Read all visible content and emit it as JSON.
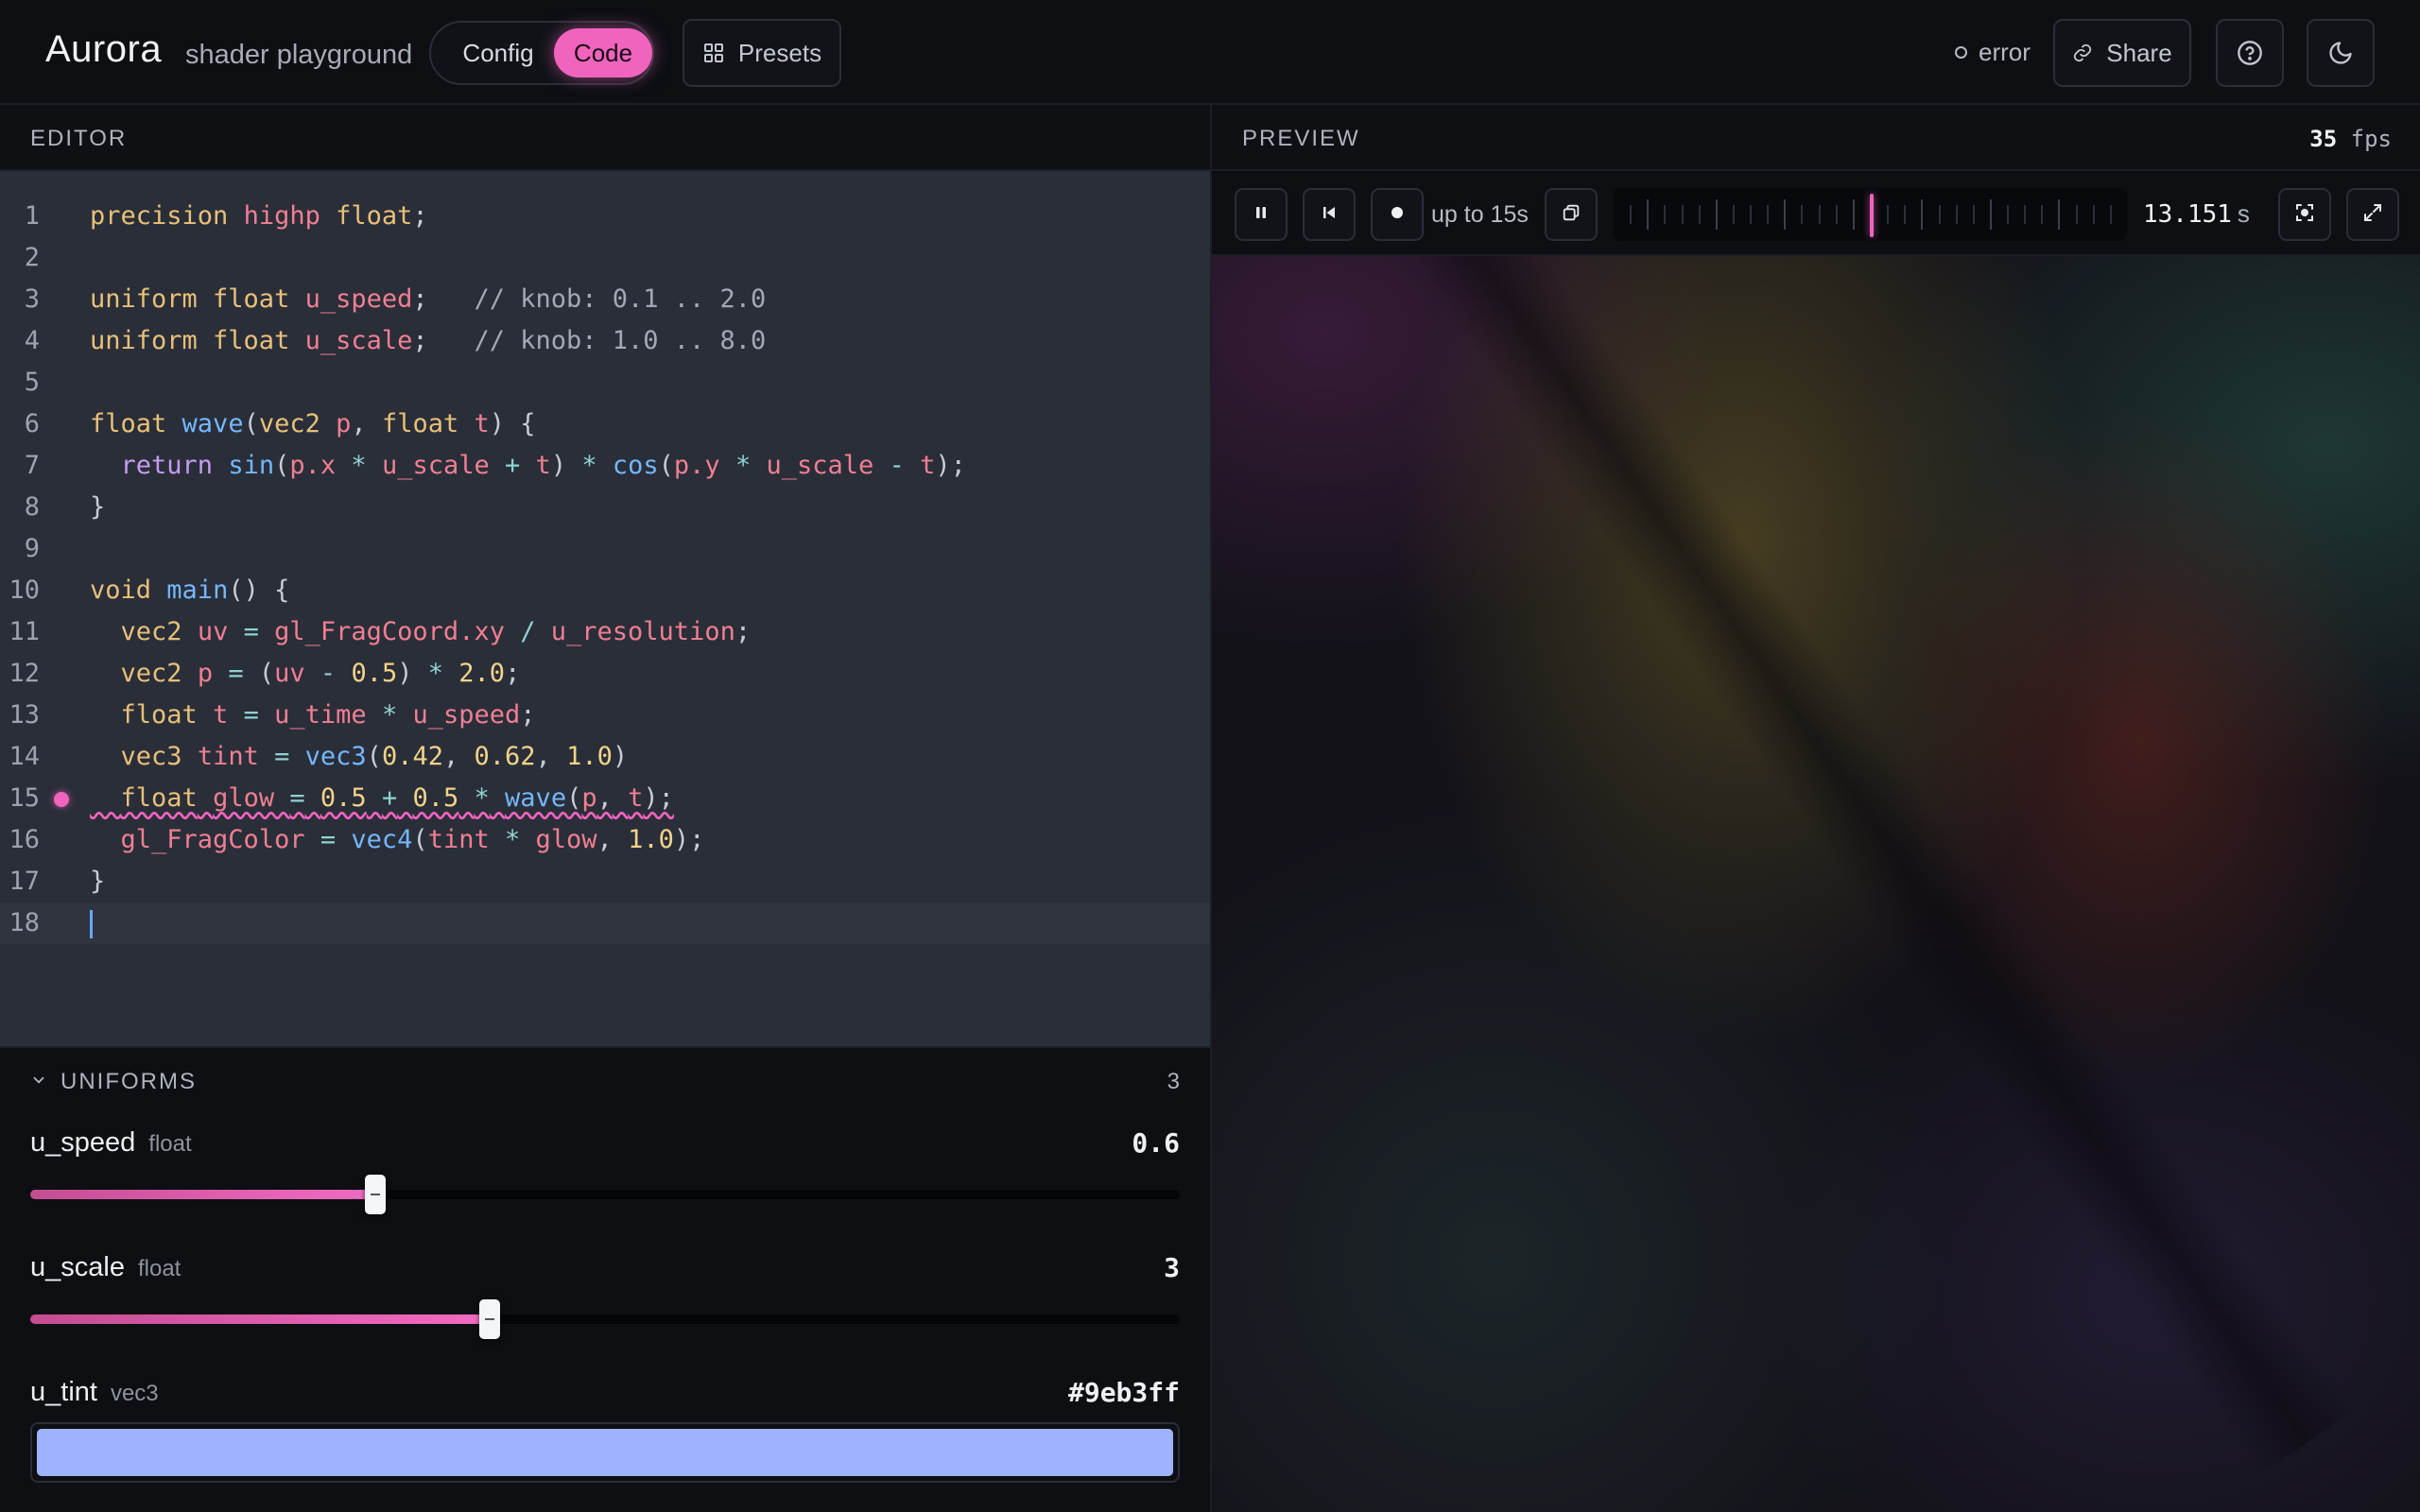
{
  "header": {
    "brand": "Aurora",
    "brand_sub": "shader playground",
    "modes": [
      "Config",
      "Code"
    ],
    "active_mode": "Code",
    "presets_label": "Presets",
    "status_label": "error",
    "share_label": "Share",
    "icons": {
      "presets": "grid-icon",
      "share": "link-icon",
      "help": "help-circle-icon",
      "theme": "moon-icon"
    }
  },
  "editor": {
    "title": "EDITOR",
    "active_line": 18,
    "error_line": 15,
    "line_numbers": [
      "1",
      "2",
      "3",
      "4",
      "5",
      "6",
      "7",
      "8",
      "9",
      "10",
      "11",
      "12",
      "13",
      "14",
      "15",
      "16",
      "17",
      "18"
    ]
  },
  "uniforms": {
    "title": "UNIFORMS",
    "count": "3",
    "items": [
      {
        "name": "u_speed",
        "type": "float",
        "value": "0.6",
        "fraction": 0.3
      },
      {
        "name": "u_scale",
        "type": "float",
        "value": "3",
        "fraction": 0.4
      },
      {
        "name": "u_tint",
        "type": "vec3",
        "value": "#9eb3ff"
      }
    ]
  },
  "preview": {
    "title": "PREVIEW",
    "fps_value": "35",
    "fps_unit": "fps",
    "record_label": "up to 15s",
    "time_value": "13.151",
    "time_unit": "s",
    "playhead_fraction": 0.5
  },
  "colors": {
    "accent": "#f064be",
    "tint": "#9eb3ff"
  }
}
